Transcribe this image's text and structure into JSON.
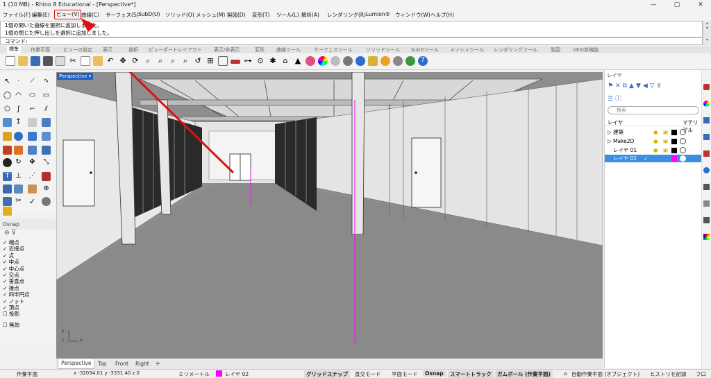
{
  "window": {
    "title": "1 (10 MB) - Rhino 8 Educational - [Perspective*]",
    "min": "—",
    "max": "▢",
    "close": "✕"
  },
  "menu": [
    "ファイル(F)",
    "編集(E)",
    "ビュー(V)",
    "曲線(C)",
    "サーフェス(S)",
    "SubD(U)",
    "ソリッド(O)",
    "メッシュ(M)",
    "製図(D)",
    "変形(T)",
    "ツール(L)",
    "解析(A)",
    "レンダリング(R)",
    "Lumion®",
    "ウィンドウ(W)",
    "ヘルプ(H)"
  ],
  "command": {
    "history": [
      "1個の開いた曲線を選択に追加しました。",
      "1個の閉じた押し出しを選択に追加しました。"
    ],
    "prompt": "コマンド:"
  },
  "tabs": [
    "標準",
    "作業平面",
    "ビューの設定",
    "表示",
    "選択",
    "ビューポートレイアウト",
    "表示/非表示",
    "変形",
    "曲線ツール",
    "サーフェスツール",
    "ソリッドツール",
    "SubDツール",
    "メッシュツール",
    "レンダリングツール",
    "製図",
    "V8の新機能"
  ],
  "viewport": {
    "label": "Perspective",
    "tabs": [
      "Perspective",
      "Top",
      "Front",
      "Right",
      "✢"
    ],
    "axis_y": "y",
    "axis_x": "x",
    "axis_z": "z"
  },
  "osnap": {
    "title": "Osnap",
    "items": [
      "端点",
      "近接点",
      "点",
      "中点",
      "中心点",
      "交点",
      "垂直点",
      "接点",
      "四半円点",
      "ノット",
      "頂点"
    ],
    "extra": [
      "投影",
      "無効"
    ]
  },
  "layers": {
    "title": "レイヤ",
    "search": "検索",
    "col_name": "レイヤ",
    "col_mat": "マテリアル",
    "rows": [
      {
        "name": "建築",
        "expand": "▷"
      },
      {
        "name": "Make2D",
        "expand": "▷"
      },
      {
        "name": "レイヤ 01",
        "expand": ""
      },
      {
        "name": "レイヤ 02",
        "expand": "",
        "current": "✓"
      }
    ]
  },
  "status": {
    "plane": "作業平面",
    "coords": "x -32034.01   y -3331.40   z 0",
    "unit": "ミリメートル",
    "layer": "レイヤ 02",
    "grid": "グリッドスナップ",
    "ortho": "直交モード",
    "planar": "平面モード",
    "osnap": "Osnap",
    "smarttrack": "スマートトラック",
    "gumball": "ガムボール (作業平面)",
    "autoplane": "自動作業平面 (オブジェクト)",
    "history": "ヒストリを記録",
    "filter": "フ口"
  },
  "colors": {
    "accent": "#1f5fbf",
    "red": "#e01010",
    "magenta": "#ff00ff"
  }
}
